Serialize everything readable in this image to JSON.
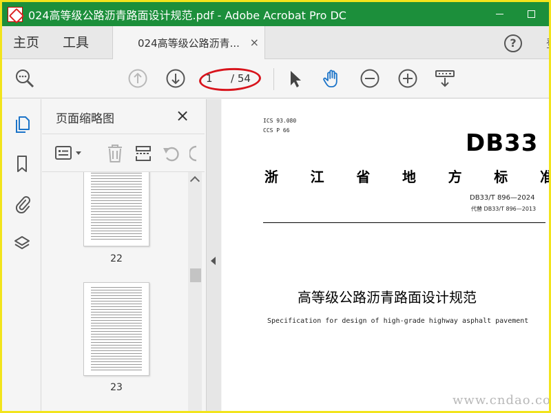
{
  "window": {
    "title": "024高等级公路沥青路面设计规范.pdf - Adobe Acrobat Pro DC"
  },
  "tabs": {
    "home": "主页",
    "tools": "工具",
    "document": "024高等级公路沥青...",
    "close_glyph": "×",
    "help_glyph": "?",
    "overflow_glyph": "登"
  },
  "toolbar": {
    "current_page": "1",
    "total_pages": "/ 54",
    "icons": [
      "search-icon",
      "page-up-icon",
      "page-down-icon",
      "select-arrow-icon",
      "hand-icon",
      "zoom-out-icon",
      "zoom-in-icon",
      "keyboard-icon"
    ]
  },
  "sidebar": {
    "icons": [
      "page-thumbnails-icon",
      "bookmark-icon",
      "attachment-icon",
      "layers-icon"
    ]
  },
  "thumbnails": {
    "title": "页面缩略图",
    "close_glyph": "×",
    "pages": [
      "22",
      "23"
    ]
  },
  "document": {
    "ics": "ICS 93.080",
    "ccs": "CCS P 66",
    "badge": "DB33",
    "heading_chars": [
      "浙",
      "江",
      "省",
      "地",
      "方",
      "标",
      "准"
    ],
    "code": "DB33/T 896—2024",
    "replaces": "代替 DB33/T 896—2013",
    "title": "高等级公路沥青路面设计规范",
    "subtitle": "Specification for design of high-grade highway asphalt pavement"
  },
  "watermark": "www.cndao.com",
  "colors": {
    "titlebar": "#1c8f3b",
    "frame": "#f2e41c",
    "annotation": "#d8141c",
    "accent": "#1a73c8"
  }
}
